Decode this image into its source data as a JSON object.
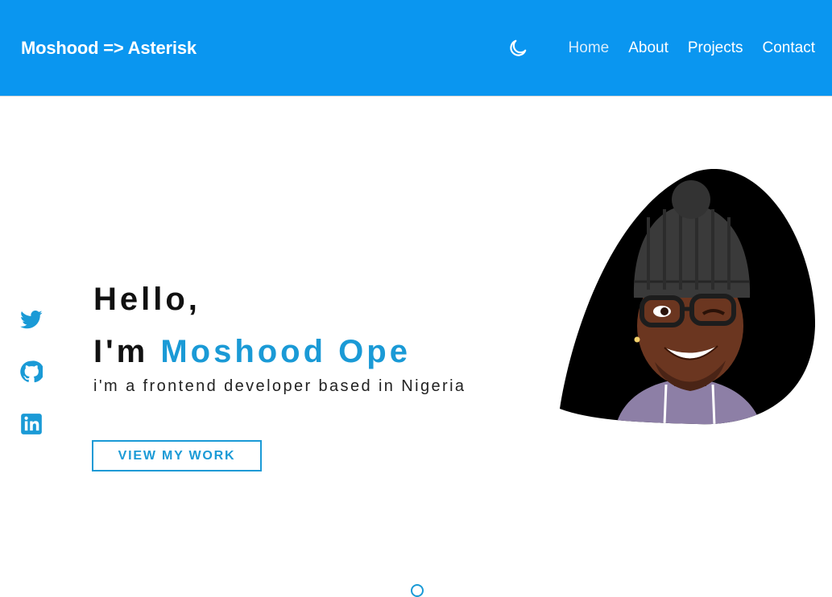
{
  "nav": {
    "brand": "Moshood => Asterisk",
    "theme_toggle_icon": "moon-icon",
    "links": [
      {
        "label": "Home",
        "active": true
      },
      {
        "label": "About",
        "active": false
      },
      {
        "label": "Projects",
        "active": false
      },
      {
        "label": "Contact",
        "active": false
      }
    ]
  },
  "socials": [
    {
      "name": "twitter-icon"
    },
    {
      "name": "github-icon"
    },
    {
      "name": "linkedin-icon"
    }
  ],
  "hero": {
    "greeting": "Hello,",
    "intro_prefix": "I'm ",
    "name": "Moshood Ope",
    "tagline": "i'm a frontend developer based in Nigeria",
    "cta_label": "VIEW MY WORK"
  },
  "colors": {
    "nav_bg": "#0a96f0",
    "accent": "#1a9ad6",
    "text": "#111111",
    "background": "#ffffff"
  }
}
